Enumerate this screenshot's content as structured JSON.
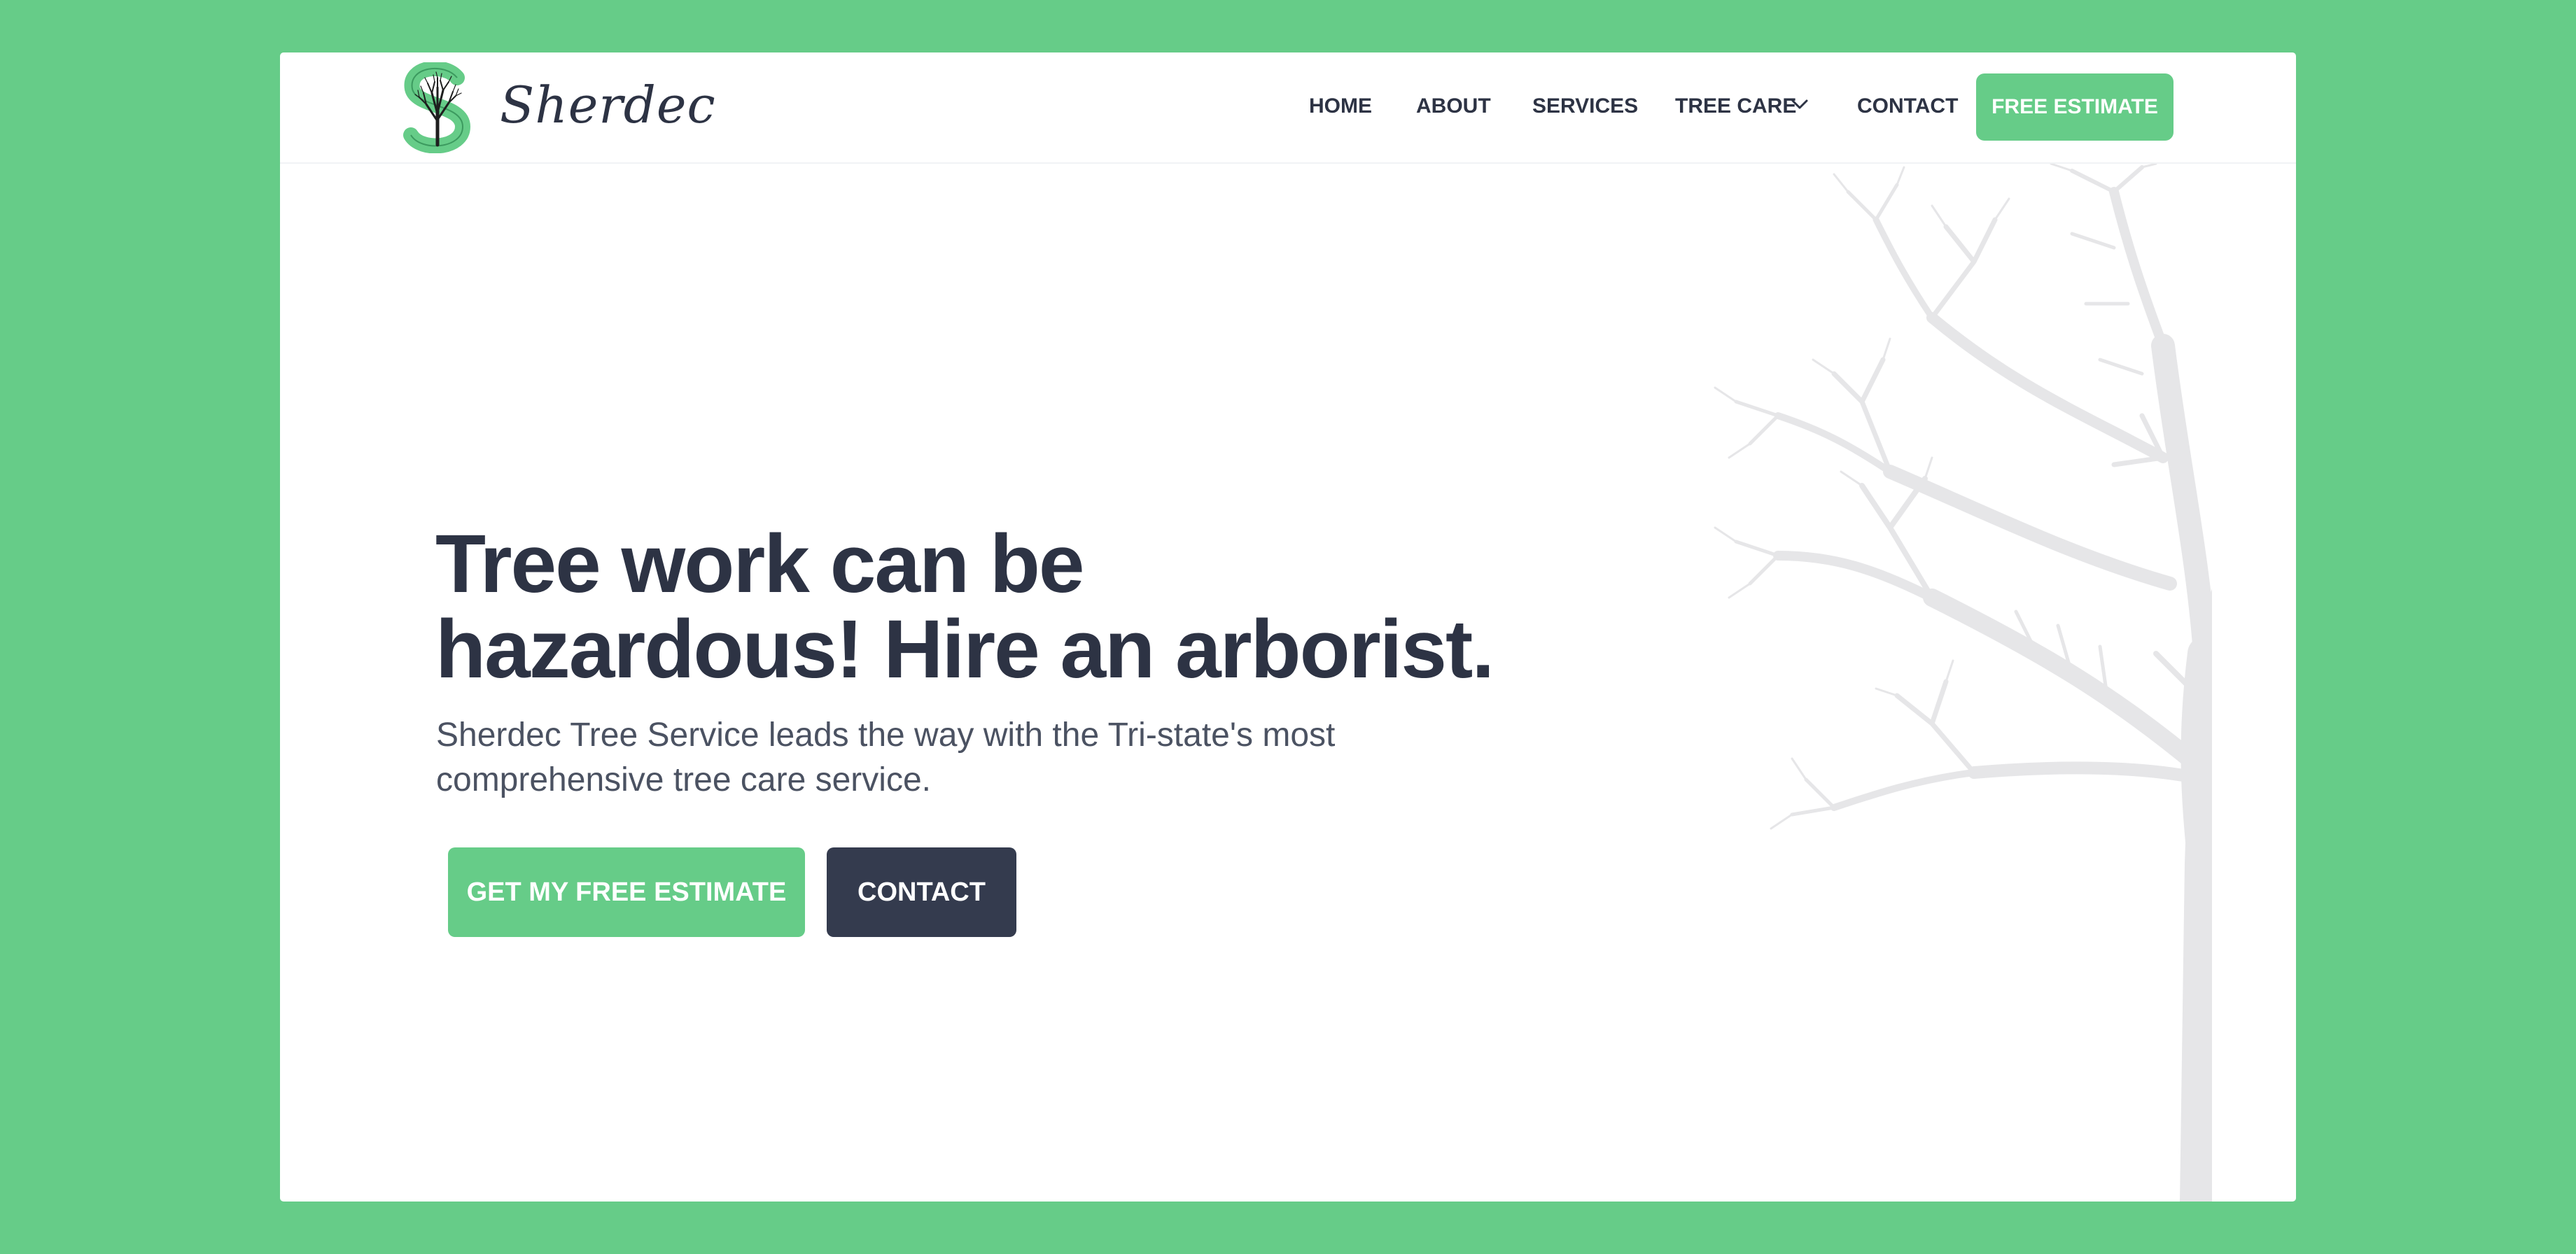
{
  "brand": {
    "name": "Sherdec",
    "logo_icon": "tree-s-logo-icon"
  },
  "nav": {
    "items": [
      {
        "label": "HOME"
      },
      {
        "label": "ABOUT"
      },
      {
        "label": "SERVICES"
      },
      {
        "label": "TREE CARE"
      },
      {
        "label": "CONTACT"
      }
    ],
    "tree_care_icon": "chevron-down-icon",
    "cta_label": "FREE ESTIMATE"
  },
  "hero": {
    "title_line1": "Tree work can be",
    "title_line2": "hazardous! Hire an arborist.",
    "subtitle_line1": "Sherdec Tree Service leads the way with the Tri-state's most",
    "subtitle_line2": "comprehensive tree care service.",
    "primary_button": "GET MY FREE ESTIMATE",
    "secondary_button": "CONTACT",
    "illustration_icon": "tree-climber-icon"
  },
  "colors": {
    "background": "#66cc88",
    "accent": "#66cc88",
    "dark": "#343b4e",
    "text": "#2d3344",
    "tree": "#e6e6e8",
    "climber": "#4f8f63"
  }
}
